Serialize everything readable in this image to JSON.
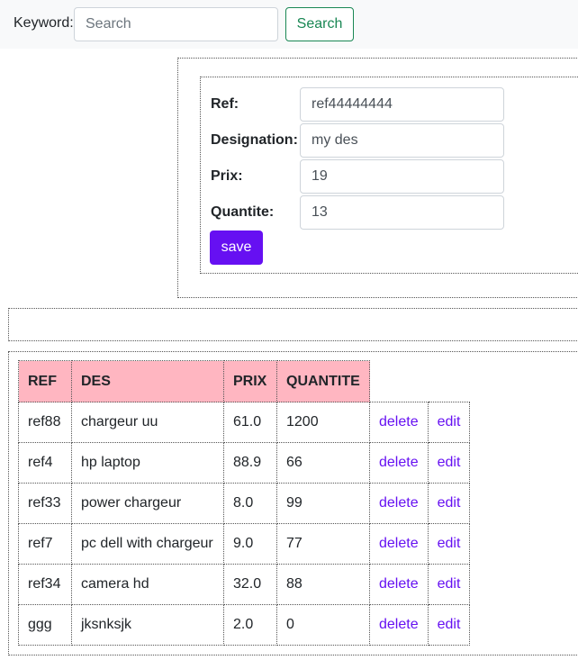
{
  "search": {
    "label": "Keyword:",
    "placeholder": "Search",
    "value": "",
    "button_label": "Search"
  },
  "form": {
    "fields": [
      {
        "label": "Ref:",
        "value": "ref44444444"
      },
      {
        "label": "Designation:",
        "value": "my des"
      },
      {
        "label": "Prix:",
        "value": "19"
      },
      {
        "label": "Quantite:",
        "value": "13"
      }
    ],
    "save_label": "save"
  },
  "table": {
    "headers": [
      "REF",
      "DES",
      "PRIX",
      "QUANTITE"
    ],
    "rows": [
      {
        "ref": "ref88",
        "des": "chargeur uu",
        "prix": "61.0",
        "quantite": "1200",
        "delete": "delete",
        "edit": "edit"
      },
      {
        "ref": "ref4",
        "des": "hp laptop",
        "prix": "88.9",
        "quantite": "66",
        "delete": "delete",
        "edit": "edit"
      },
      {
        "ref": "ref33",
        "des": "power chargeur",
        "prix": "8.0",
        "quantite": "99",
        "delete": "delete",
        "edit": "edit"
      },
      {
        "ref": "ref7",
        "des": "pc dell with chargeur",
        "prix": "9.0",
        "quantite": "77",
        "delete": "delete",
        "edit": "edit"
      },
      {
        "ref": "ref34",
        "des": "camera hd",
        "prix": "32.0",
        "quantite": "88",
        "delete": "delete",
        "edit": "edit"
      },
      {
        "ref": "ggg",
        "des": "jksnksjk",
        "prix": "2.0",
        "quantite": "0",
        "delete": "delete",
        "edit": "edit"
      }
    ]
  },
  "colors": {
    "header_bg": "#ffb6c1",
    "save_bg": "#6610f2",
    "search_btn": "#198754",
    "link": "#6610f2"
  }
}
